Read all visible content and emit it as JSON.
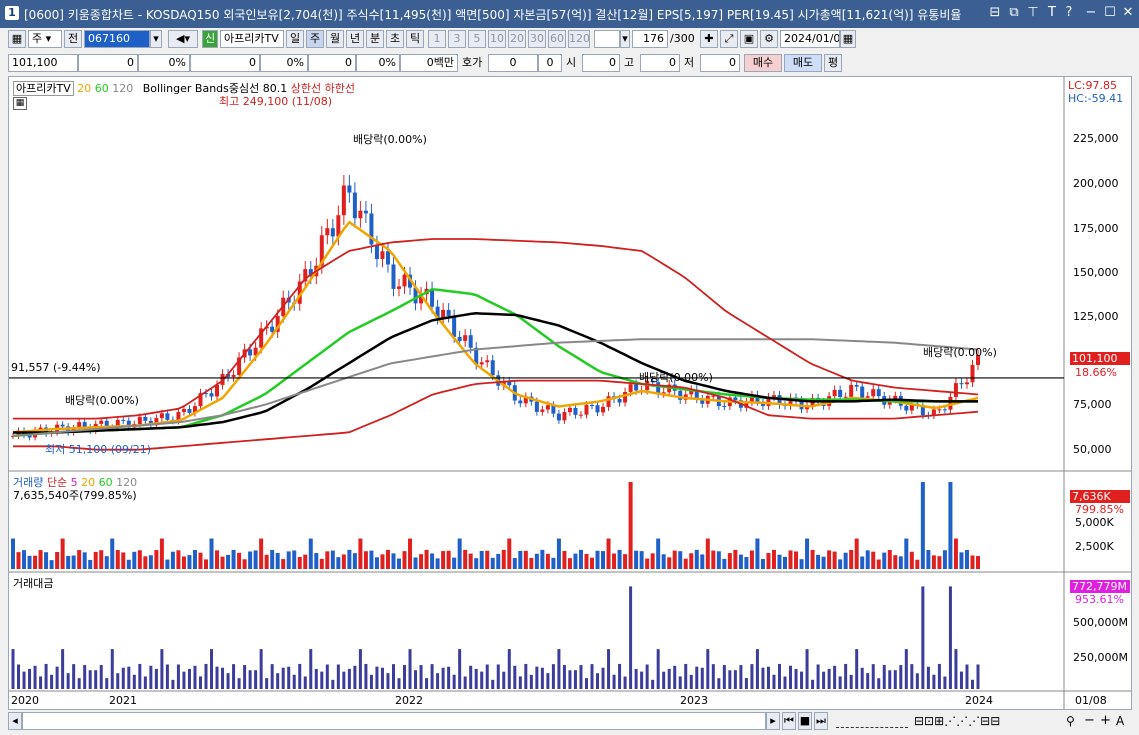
{
  "window": {
    "title": "[0600] 키움종합차트 - KOSDAQ150 외국인보유[2,704(천)] 주식수[11,495(천)] 액면[500] 자본금[57(억)] 결산[12월] EPS[5,197] PER[19.45] 시가총액[11,621(억)] 유통비율",
    "icon_label": "1",
    "controls": [
      "minimize",
      "maximize",
      "close"
    ]
  },
  "toolbar": {
    "type_select": "주",
    "prev_label": "전",
    "code": "067160",
    "sin_badge": "신",
    "stock_name": "아프리카TV",
    "periods": [
      "일",
      "주",
      "월",
      "년",
      "분",
      "초",
      "틱"
    ],
    "selected_period": "주",
    "intervals": [
      "1",
      "3",
      "5",
      "10",
      "20",
      "30",
      "60",
      "120"
    ],
    "count": "176",
    "count_total": "/300",
    "date": "2024/01/08"
  },
  "quote": {
    "price": "101,100",
    "change": "0",
    "change_pct": "0%",
    "v1": "0",
    "v1_pct": "0%",
    "v2": "0",
    "v2_pct": "0%",
    "unit": "0백만",
    "hoga_label": "호가",
    "hoga1": "0",
    "hoga2": "0",
    "open_label": "시",
    "open": "0",
    "high_label": "고",
    "high": "0",
    "low_label": "저",
    "low": "0",
    "buy_label": "매수",
    "sell_label": "매도",
    "eval_label": "평"
  },
  "price_panel": {
    "legend_name": "아프리카TV",
    "ma_labels": [
      "20",
      "60",
      "120"
    ],
    "bb_label": "Bollinger Bands중심선 80.1",
    "bb_upper": "상한선",
    "bb_lower": "하한선",
    "lc": "LC:97.85",
    "hc": "HC:-59.41",
    "max_label": "최고 249,100 (11/08)",
    "min_label": "최저 51,100 (09/21)",
    "dividend_label": "배당락(0.00%)",
    "hline_label": "91,557 (-9.44%)",
    "last_price_tag": "101,100",
    "last_change_tag": "18.66%",
    "y_ticks": [
      "225,000",
      "200,000",
      "175,000",
      "150,000",
      "125,000",
      "100,000",
      "75,000",
      "50,000"
    ]
  },
  "volume_panel": {
    "title": "거래량",
    "ma_type": "단순",
    "ma_labels": [
      "5",
      "20",
      "60",
      "120"
    ],
    "value_text": "7,635,540주(799.85%)",
    "tag": "7,636K",
    "tag_pct": "799.85%",
    "y_ticks": [
      "5,000K",
      "2,500K"
    ]
  },
  "amount_panel": {
    "title": "거래대금",
    "tag": "772,779M",
    "tag_pct": "953.61%",
    "y_ticks": [
      "500,000M",
      "250,000M"
    ]
  },
  "x_axis": {
    "labels": [
      "2020",
      "2021",
      "2022",
      "2023",
      "2024"
    ],
    "current": "01/08"
  },
  "colors": {
    "up": "#e0201f",
    "down": "#1f5fc8",
    "ma20": "#f0a500",
    "ma60": "#22cc22",
    "ma120": "#000000",
    "bb_center": "#888888",
    "bb_band": "#d02020",
    "tag_red": "#e0201f",
    "tag_magenta": "#e020e0",
    "title_blue": "#3b5f93"
  },
  "chart_data": {
    "type": "line",
    "title": "",
    "x": [
      "2020",
      "2021",
      "2022",
      "2023",
      "2024"
    ],
    "series": [
      {
        "name": "아프리카TV",
        "values": [
          58000,
          62000,
          64000,
          66000,
          70000,
          90000,
          118000,
          150000,
          200000,
          150000,
          135000,
          105000,
          80000,
          70000,
          75000,
          88000,
          82000,
          77000,
          79000,
          76000,
          85000,
          78000,
          70000,
          101100
        ]
      },
      {
        "name": "20",
        "values": [
          60000,
          62000,
          63000,
          64000,
          67000,
          80000,
          110000,
          145000,
          182000,
          165000,
          130000,
          100000,
          82000,
          75000,
          78000,
          84000,
          80000,
          78000,
          77000,
          75000,
          80000,
          78000,
          74000,
          80000
        ]
      },
      {
        "name": "60",
        "values": [
          58000,
          60000,
          61000,
          62000,
          63000,
          70000,
          82000,
          100000,
          118000,
          130000,
          143000,
          140000,
          128000,
          110000,
          95000,
          88000,
          85000,
          82000,
          80000,
          79000,
          79000,
          78000,
          78000,
          78000
        ]
      }
    ],
    "volume_series": {
      "name": "거래량",
      "last": "7,635,540"
    },
    "ylim": [
      40000,
      260000
    ]
  }
}
